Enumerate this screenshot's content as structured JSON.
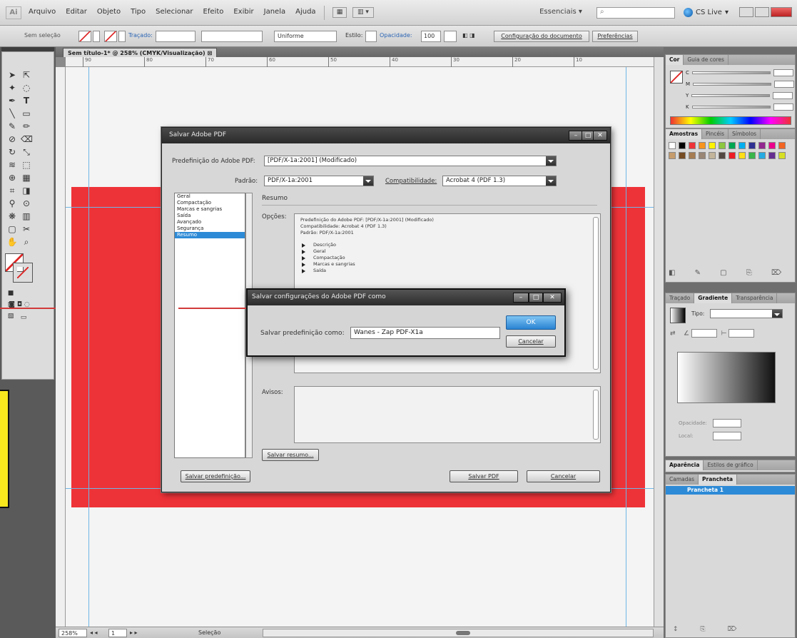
{
  "menubar": {
    "logo": "Ai",
    "menus": [
      "Arquivo",
      "Editar",
      "Objeto",
      "Tipo",
      "Selecionar",
      "Efeito",
      "Exibir",
      "Janela",
      "Ajuda"
    ],
    "workspace": "Essenciais",
    "cslive": "CS Live"
  },
  "controlbar": {
    "selection": "Sem seleção",
    "stroke_label": "Traçado:",
    "brush": "Uniforme",
    "style_label": "Estilo:",
    "opacity_label": "Opacidade:",
    "opacity_value": "100",
    "doc_setup": "Configuração do documento",
    "preferences": "Preferências"
  },
  "document": {
    "tab": "Sem título-1* @ 258% (CMYK/Visualização)",
    "ruler_ticks": [
      "90",
      "80",
      "70",
      "60",
      "50",
      "40",
      "30",
      "20",
      "10"
    ],
    "colors": {
      "artboard_red": "#ee3338",
      "guide": "#6fb6e6"
    }
  },
  "statusbar": {
    "zoom": "258%",
    "page": "1",
    "tool": "Seleção"
  },
  "panels": {
    "color_tabs": [
      "Cor",
      "Guia de cores"
    ],
    "cmyk": [
      "C",
      "M",
      "Y",
      "K"
    ],
    "swatch_tabs": [
      "Amostras",
      "Pincéis",
      "Símbolos"
    ],
    "gradient_tabs": [
      "Traçado",
      "Gradiente",
      "Transparência"
    ],
    "gradient_type": "Tipo:",
    "opacity_label": "Opacidade:",
    "location_label": "Local:",
    "appearance_tabs": [
      "Aparência",
      "Estilos de gráfico"
    ],
    "layers_tabs": [
      "Camadas",
      "Prancheta"
    ],
    "artboard_item": "Prancheta 1",
    "swatch_colors": [
      "#ffffff",
      "#000000",
      "#ee3338",
      "#f7941d",
      "#fff200",
      "#8dc63f",
      "#00a651",
      "#00aeef",
      "#2e3192",
      "#92278f",
      "#ec008c",
      "#f26522",
      "#c69c6d",
      "#754c24",
      "#a67c52",
      "#998675",
      "#c2b59b",
      "#534741",
      "#ed1c24",
      "#ffde17",
      "#39b54a",
      "#27aae1",
      "#662d91",
      "#d7df23"
    ]
  },
  "dialog_pdf": {
    "title": "Salvar Adobe PDF",
    "preset_label": "Predefinição do Adobe PDF:",
    "preset_value": "[PDF/X-1a:2001] (Modificado)",
    "standard_label": "Padrão:",
    "standard_value": "PDF/X-1a:2001",
    "compat_label": "Compatibilidade:",
    "compat_value": "Acrobat 4 (PDF 1.3)",
    "categories": [
      "Geral",
      "Compactação",
      "Marcas e sangrias",
      "Saída",
      "Avançado",
      "Segurança",
      "Resumo"
    ],
    "section_title": "Resumo",
    "options_label": "Opções:",
    "summary_lines": [
      "Predefinição do Adobe PDF: [PDF/X-1a:2001] (Modificado)",
      "Compatibilidade: Acrobat 4 (PDF 1.3)",
      "Padrão: PDF/X-1a:2001"
    ],
    "tree_items": [
      "Descrição",
      "Geral",
      "Compactação",
      "Marcas e sangrias",
      "Saída"
    ],
    "warnings_label": "Avisos:",
    "save_summary": "Salvar resumo...",
    "save_preset": "Salvar predefinição...",
    "save_pdf": "Salvar PDF",
    "cancel": "Cancelar"
  },
  "dialog_preset": {
    "title": "Salvar configurações do Adobe PDF como",
    "field_label": "Salvar predefinição como:",
    "field_value": "Wanes - Zap PDF-X1a",
    "ok": "OK",
    "cancel": "Cancelar"
  }
}
